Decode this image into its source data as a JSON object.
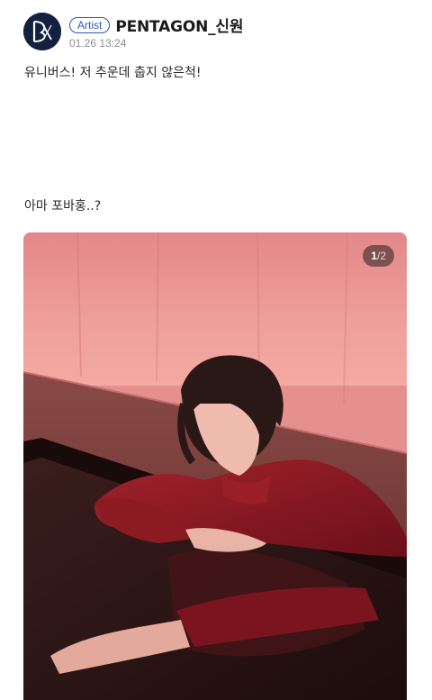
{
  "post": {
    "author": {
      "badge": "Artist",
      "name": "PENTAGON_신원",
      "timestamp": "01.26 13:24",
      "avatar_icon": "group-logo-icon"
    },
    "body": {
      "line1": "유니버스! 저 추운데 춥지 않은척!",
      "line2": "아마 포바홍..?"
    },
    "image": {
      "current": "1",
      "separator": "/",
      "total": "2"
    }
  },
  "colors": {
    "badge": "#2d5ab7",
    "avatar_bg": "#13203f",
    "backdrop": "#e58f8e",
    "shirt": "#8c1a22",
    "floor": "#3a1c1c"
  }
}
